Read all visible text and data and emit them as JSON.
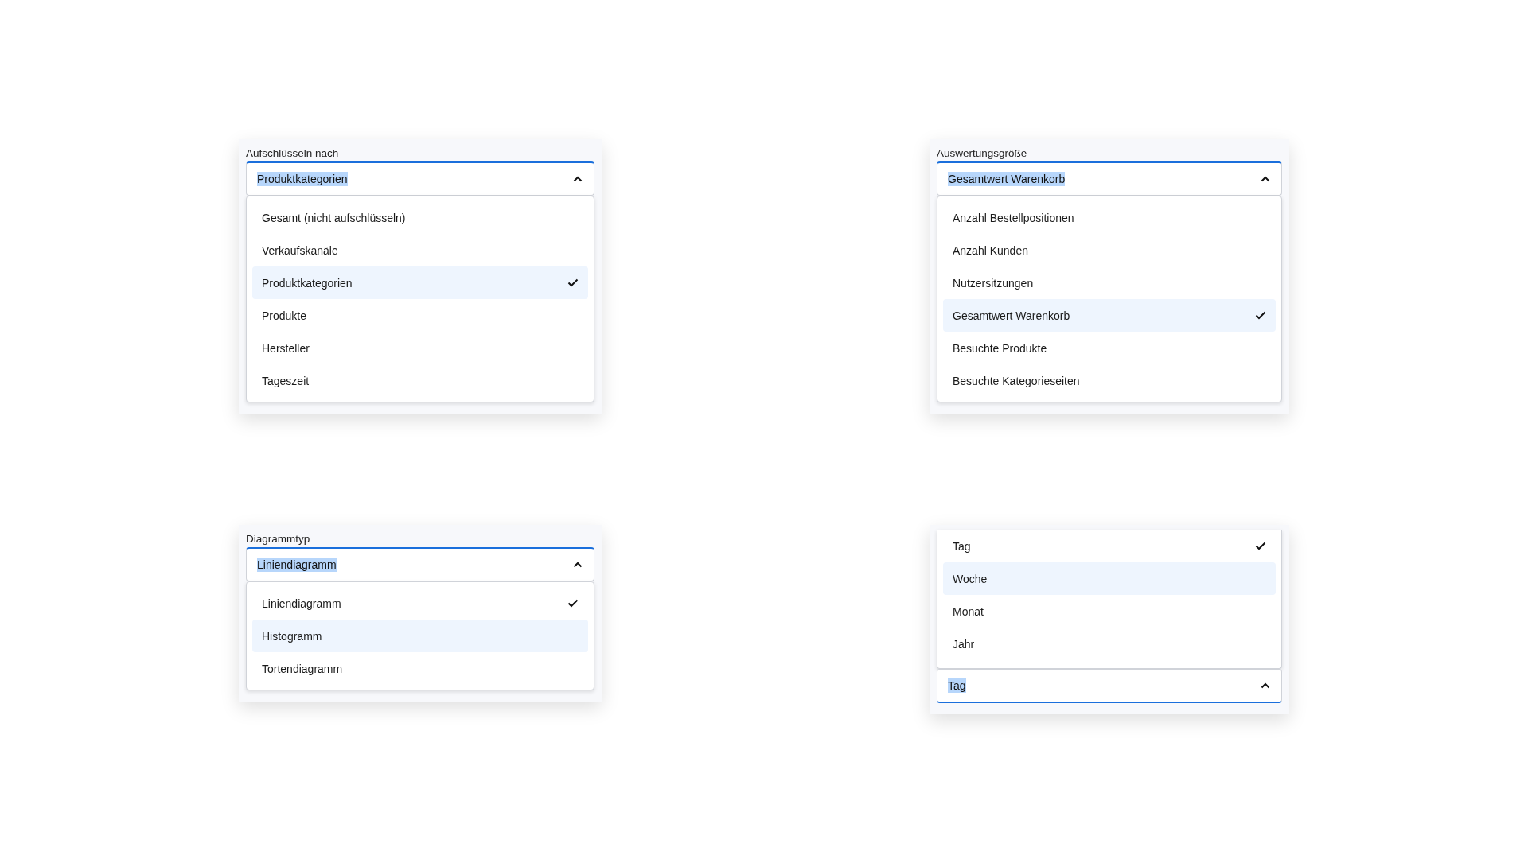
{
  "panels": [
    {
      "label": "Aufschlüsseln nach",
      "value": "Produktkategorien",
      "kind": "drop-down",
      "options": [
        {
          "label": "Gesamt (nicht aufschlüsseln)",
          "selected": false,
          "highlighted": false
        },
        {
          "label": "Verkaufskanäle",
          "selected": false,
          "highlighted": false
        },
        {
          "label": "Produktkategorien",
          "selected": true,
          "highlighted": true
        },
        {
          "label": "Produkte",
          "selected": false,
          "highlighted": false
        },
        {
          "label": "Hersteller",
          "selected": false,
          "highlighted": false
        },
        {
          "label": "Tageszeit",
          "selected": false,
          "highlighted": false
        }
      ]
    },
    {
      "label": "Auswertungsgröße",
      "value": "Gesamtwert Warenkorb",
      "kind": "drop-down",
      "options": [
        {
          "label": "Anzahl Bestellpositionen",
          "selected": false,
          "highlighted": false
        },
        {
          "label": "Anzahl Kunden",
          "selected": false,
          "highlighted": false
        },
        {
          "label": "Nutzersitzungen",
          "selected": false,
          "highlighted": false
        },
        {
          "label": "Gesamtwert Warenkorb",
          "selected": true,
          "highlighted": true
        },
        {
          "label": "Besuchte Produkte",
          "selected": false,
          "highlighted": false
        },
        {
          "label": "Besuchte Kategorieseiten",
          "selected": false,
          "highlighted": false
        }
      ]
    },
    {
      "label": "Diagrammtyp",
      "value": "Liniendiagramm",
      "kind": "drop-down",
      "options": [
        {
          "label": "Liniendiagramm",
          "selected": true,
          "highlighted": false
        },
        {
          "label": "Histogramm",
          "selected": false,
          "highlighted": true
        },
        {
          "label": "Tortendiagramm",
          "selected": false,
          "highlighted": false
        }
      ]
    },
    {
      "value": "Tag",
      "kind": "drop-up",
      "options": [
        {
          "label": "Tag",
          "selected": true,
          "highlighted": false
        },
        {
          "label": "Woche",
          "selected": false,
          "highlighted": true
        },
        {
          "label": "Monat",
          "selected": false,
          "highlighted": false
        },
        {
          "label": "Jahr",
          "selected": false,
          "highlighted": false
        }
      ]
    }
  ]
}
